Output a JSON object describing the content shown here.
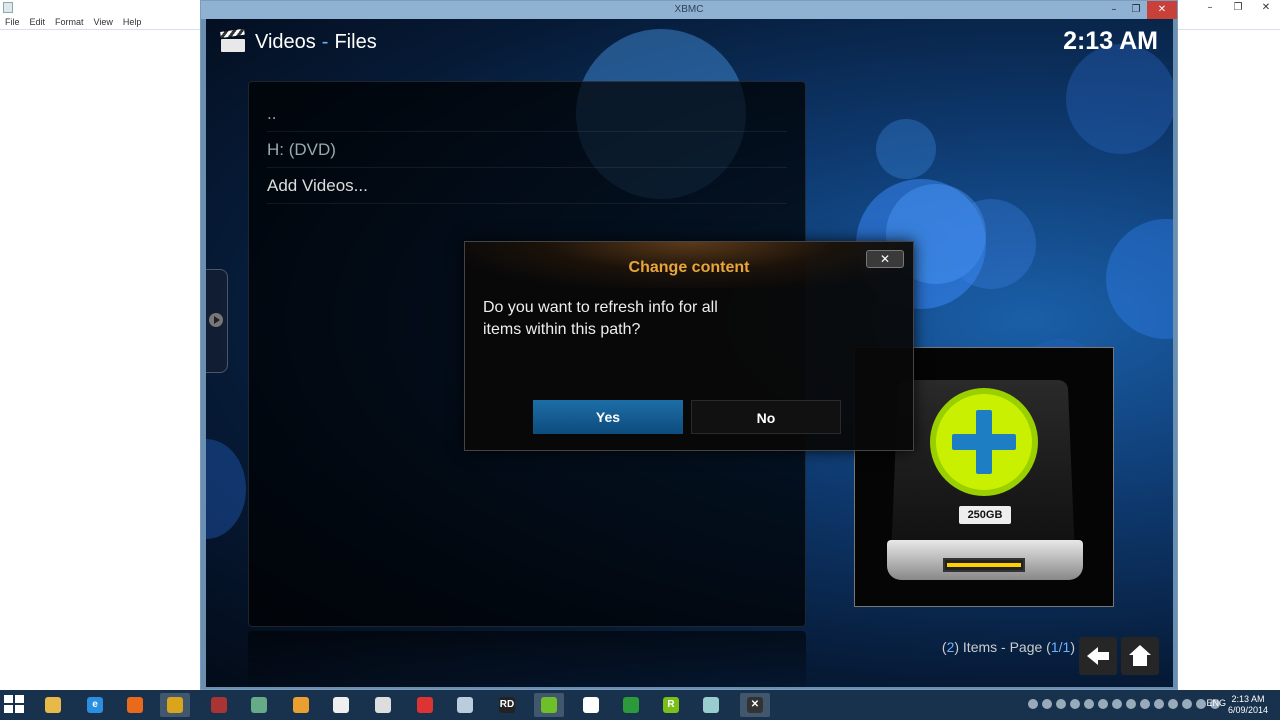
{
  "notepad": {
    "menu": [
      "File",
      "Edit",
      "Format",
      "View",
      "Help"
    ],
    "controls": [
      "–",
      "❐",
      "✕"
    ]
  },
  "window": {
    "title": "XBMC",
    "controls": [
      "–",
      "❐",
      "✕"
    ]
  },
  "header": {
    "section": "Videos",
    "separator": "-",
    "subsection": "Files",
    "clock": "2:13 AM"
  },
  "file_list": {
    "items": [
      "..",
      "H: (DVD)",
      "Add Videos..."
    ]
  },
  "thumbnail": {
    "drive_label": "250GB"
  },
  "footer": {
    "count": "2",
    "items_text": "Items - Page",
    "page": "1/1"
  },
  "dialog": {
    "title": "Change content",
    "close_glyph": "✕",
    "message": "Do you want to refresh info for all items within this path?",
    "yes": "Yes",
    "no": "No"
  },
  "taskbar": {
    "apps": [
      {
        "name": "file-explorer",
        "glyph": "",
        "color": "#e8b84a"
      },
      {
        "name": "internet-explorer",
        "glyph": "e",
        "color": "#2a8fe0"
      },
      {
        "name": "firefox",
        "glyph": "",
        "color": "#e86a1a"
      },
      {
        "name": "chrome",
        "glyph": "",
        "color": "#d9a51c"
      },
      {
        "name": "app-5",
        "glyph": "",
        "color": "#a33"
      },
      {
        "name": "app-6",
        "glyph": "",
        "color": "#6a8"
      },
      {
        "name": "app-7",
        "glyph": "",
        "color": "#e9a030"
      },
      {
        "name": "app-8",
        "glyph": "",
        "color": "#eee"
      },
      {
        "name": "app-9",
        "glyph": "",
        "color": "#ddd"
      },
      {
        "name": "app-10",
        "glyph": "",
        "color": "#d33"
      },
      {
        "name": "app-11",
        "glyph": "",
        "color": "#bcd"
      },
      {
        "name": "remote-desktop",
        "glyph": "RD",
        "color": "#222"
      },
      {
        "name": "nvidia",
        "glyph": "",
        "color": "#6fbf2a"
      },
      {
        "name": "app-14",
        "glyph": "",
        "color": "#fff"
      },
      {
        "name": "app-15",
        "glyph": "",
        "color": "#2a9a3a"
      },
      {
        "name": "app-16",
        "glyph": "R",
        "color": "#7bbf1a"
      },
      {
        "name": "app-17",
        "glyph": "",
        "color": "#9cc"
      },
      {
        "name": "xbmc",
        "glyph": "✕",
        "color": "#333"
      }
    ],
    "lang": "ENG",
    "time": "2:13 AM",
    "date": "6/09/2014"
  }
}
